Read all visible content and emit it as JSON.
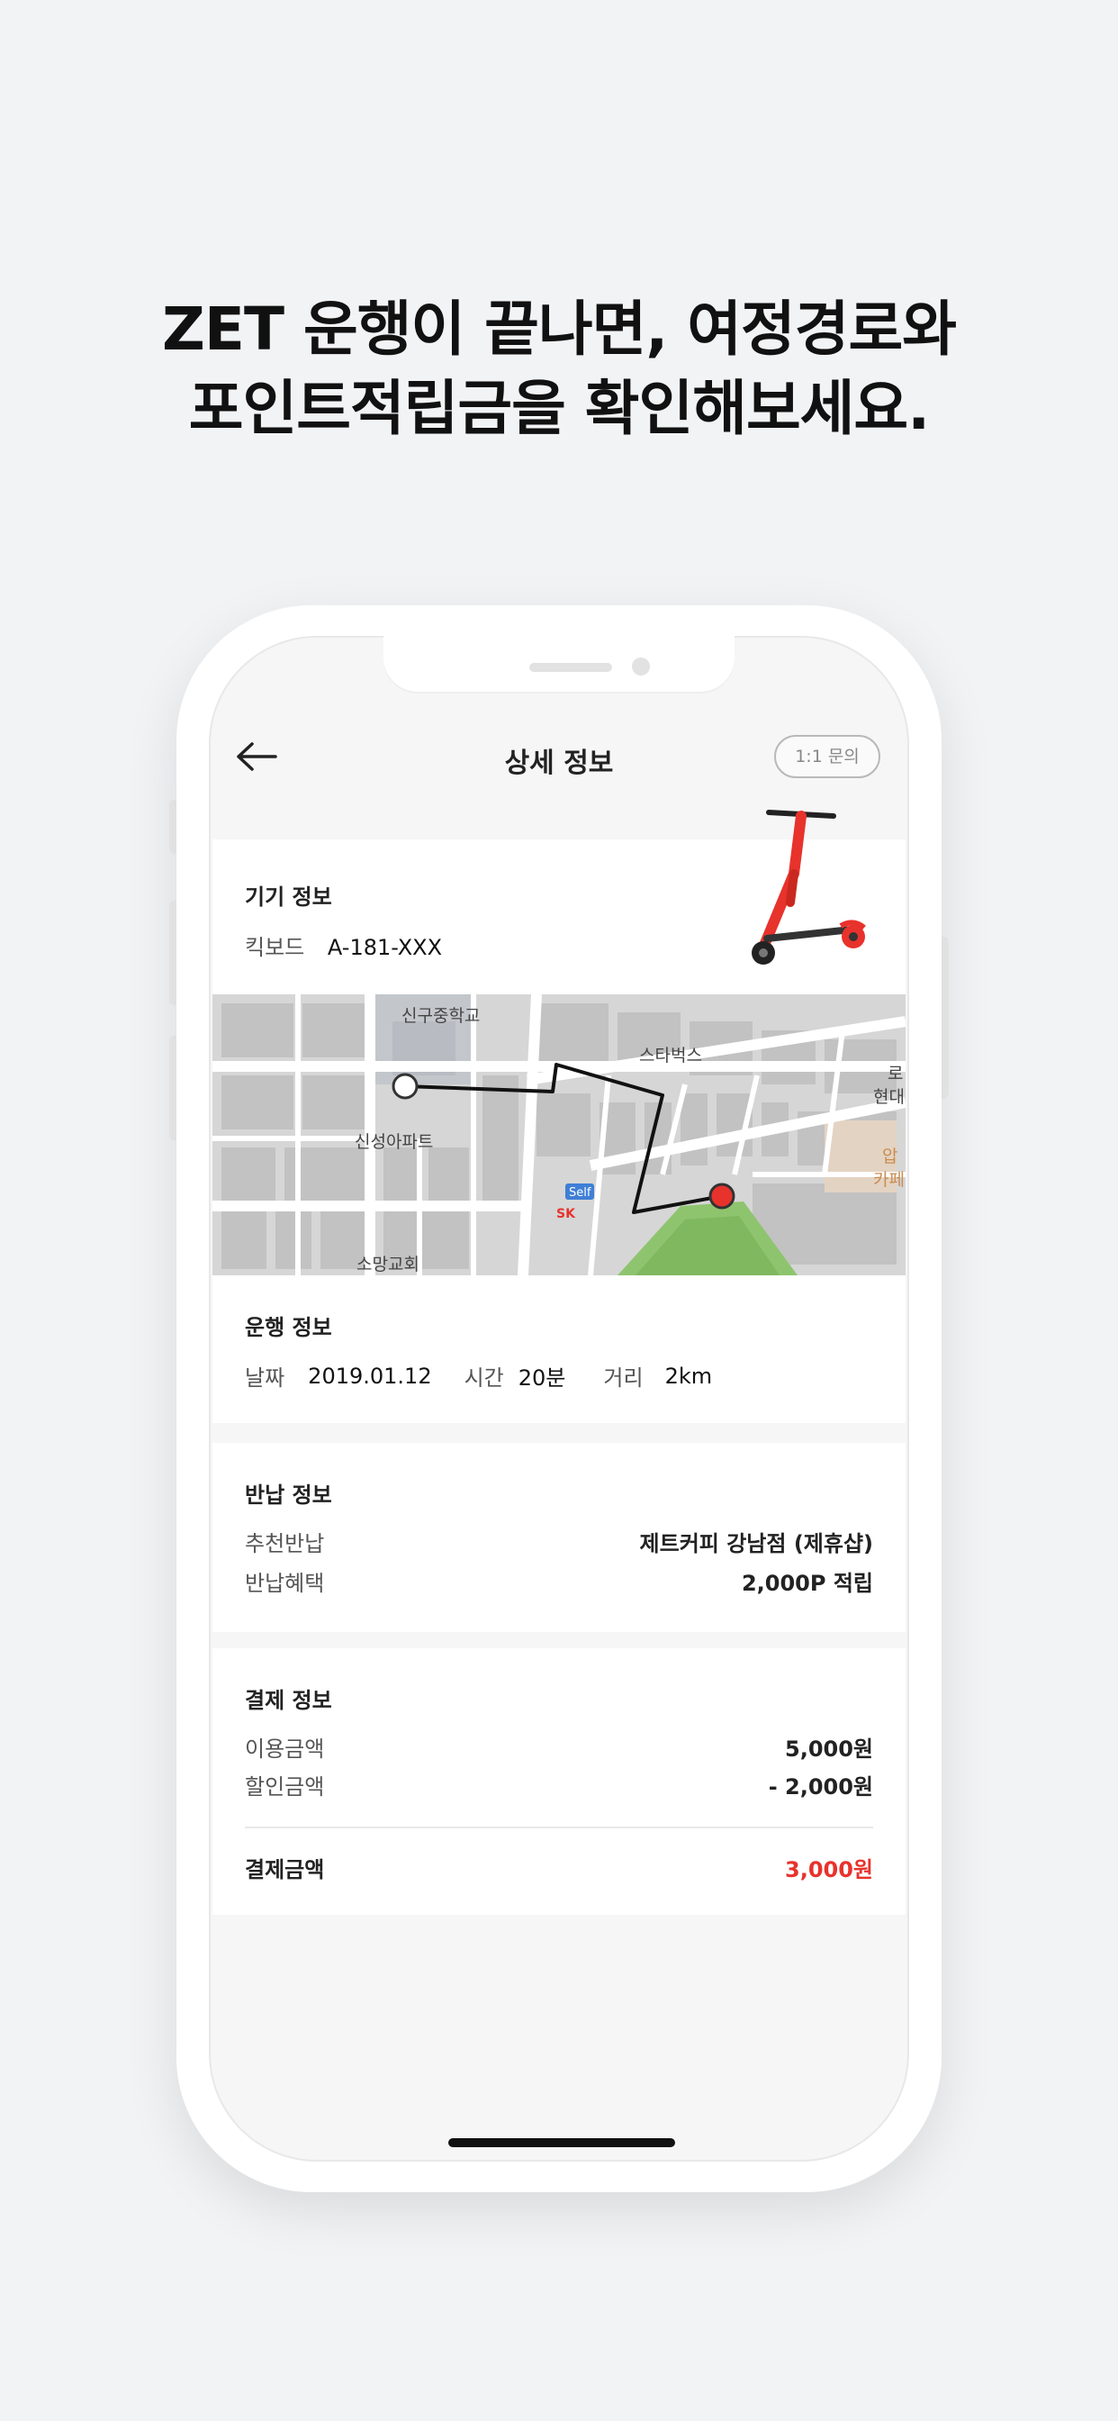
{
  "headline": {
    "line1": "ZET 운행이 끝나면, 여정경로와",
    "line2": "포인트적립금을 확인해보세요."
  },
  "nav": {
    "title": "상세 정보",
    "inquiry_button": "1:1 문의",
    "back_icon": "arrow-left-icon"
  },
  "device_info": {
    "title": "기기 정보",
    "label": "킥보드",
    "device_id": "A-181-XXX",
    "image_icon": "scooter-icon"
  },
  "map": {
    "labels": [
      "신구중학교",
      "스타벅스",
      "신성아파트",
      "소망교회",
      "로",
      "현대",
      "압",
      "카페"
    ],
    "badge_self": "Self",
    "badge_sk": "SK"
  },
  "ride_info": {
    "title": "운행 정보",
    "date_label": "날짜",
    "date_value": "2019.01.12",
    "time_label": "시간",
    "time_value": "20분",
    "distance_label": "거리",
    "distance_value": "2km"
  },
  "return_info": {
    "title": "반납 정보",
    "recommend_label": "추천반납",
    "recommend_value": "제트커피 강남점 (제휴샵)",
    "benefit_label": "반납혜택",
    "benefit_value": "2,000P 적립"
  },
  "payment_info": {
    "title": "결제 정보",
    "usage_label": "이용금액",
    "usage_value": "5,000원",
    "discount_label": "할인금액",
    "discount_value": "- 2,000원",
    "total_label": "결제금액",
    "total_value": "3,000원"
  },
  "colors": {
    "accent_red": "#e8322c",
    "background": "#f2f3f5"
  }
}
